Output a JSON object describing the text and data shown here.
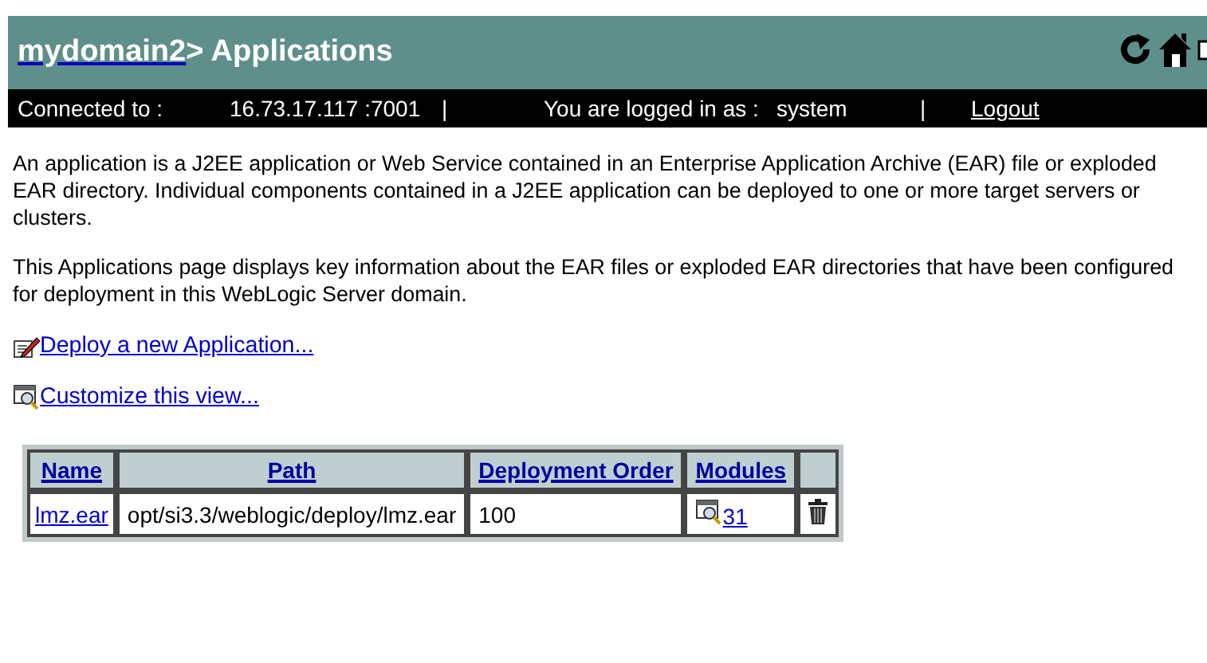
{
  "header": {
    "domain_link": "mydomain2",
    "title": "> Applications"
  },
  "status_bar": {
    "connected_label": "Connected to :",
    "address": "16.73.17.117 :7001",
    "separator_1": "|",
    "logged_label": "You are logged in as :",
    "user": "system",
    "separator_2": "|",
    "logout": "Logout"
  },
  "intro": [
    "An application is a J2EE application or Web Service contained in an Enterprise Application Archive (EAR) file or exploded EAR directory. Individual components contained in a J2EE application can be deployed to one or more target servers or clusters.",
    "This Applications page displays key information about the EAR files or exploded EAR directories that have been configured for deployment in this WebLogic Server domain."
  ],
  "actions": [
    {
      "kind": "deploy",
      "label": "Deploy a new Application..."
    },
    {
      "kind": "customize",
      "label": "Customize this view..."
    }
  ],
  "table": {
    "columns": [
      "Name",
      "Path",
      "Deployment Order",
      "Modules"
    ],
    "rows": [
      {
        "name": "lmz.ear",
        "path": "opt/si3.3/weblogic/deploy/lmz.ear",
        "order": "100",
        "modules": "31"
      }
    ]
  }
}
